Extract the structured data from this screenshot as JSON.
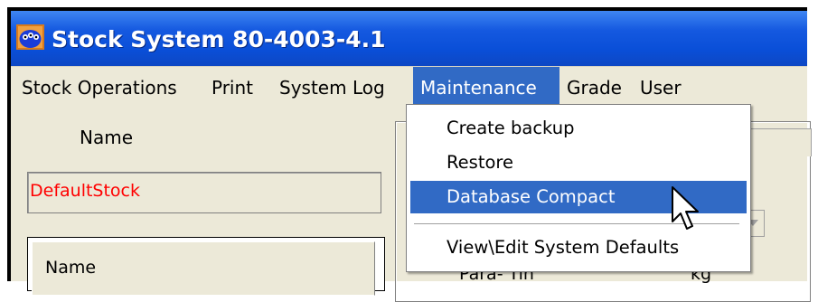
{
  "window": {
    "title": "Stock System 80-4003-4.1",
    "icon": "app-logo-icon",
    "title_bar_color": "#0a4fd8"
  },
  "menubar": {
    "items": [
      {
        "label": "Stock Operations"
      },
      {
        "label": "Print"
      },
      {
        "label": "System Log"
      },
      {
        "label": "Maintenance",
        "active": true
      },
      {
        "label": "Grade"
      },
      {
        "label": "User"
      }
    ],
    "active_color": "#316ac5"
  },
  "maintenance_menu": {
    "items": [
      {
        "label": "Create backup"
      },
      {
        "label": "Restore"
      },
      {
        "label": "Database Compact",
        "highlighted": true
      },
      {
        "label": "View\\Edit System Defaults"
      }
    ]
  },
  "form": {
    "name_label": "Name",
    "stock_value": "DefaultStock",
    "stock_value_color": "#ff0000",
    "list_header": "Name",
    "ghost_text_a": "Para- Tin",
    "ghost_text_b": "kg"
  },
  "cursor": {
    "icon": "mouse-pointer-icon"
  }
}
